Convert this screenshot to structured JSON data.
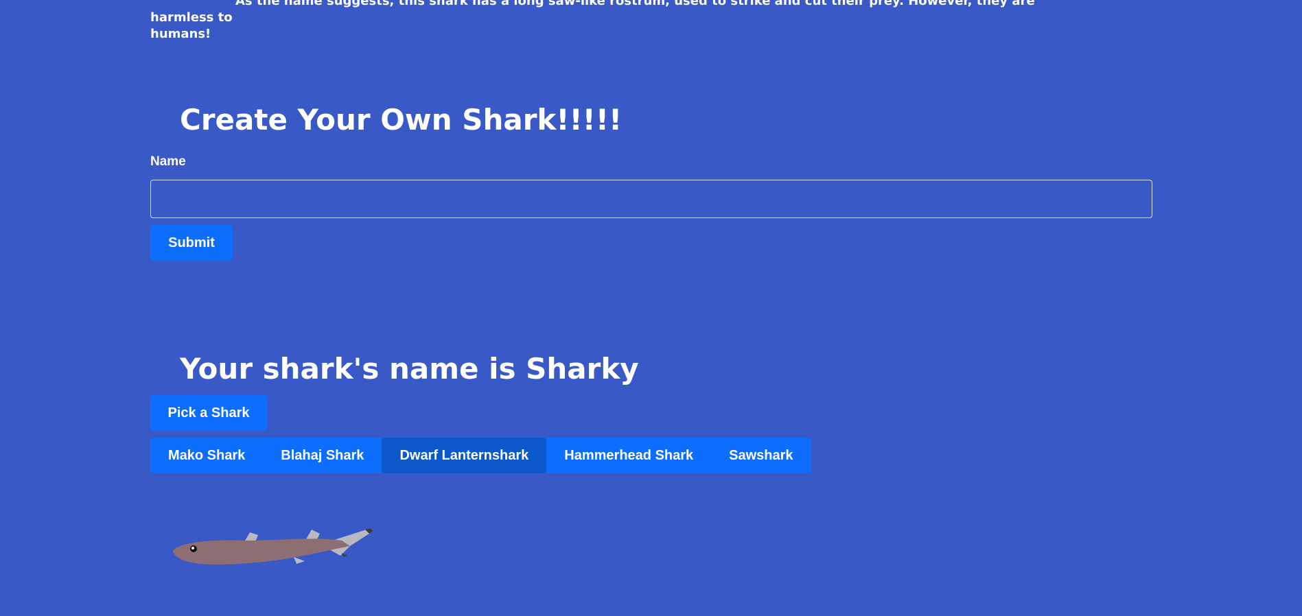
{
  "intro": {
    "line1": "As the name suggests, this shark has a long saw-like rostrum, used to strike and cut their prey. However, they are harmless to",
    "line2": "humans!"
  },
  "create_form": {
    "title": "Create Your Own Shark!!!!!",
    "name_label": "Name",
    "name_value": "",
    "submit_label": "Submit"
  },
  "result": {
    "title": "Your shark's name is Sharky",
    "pick_label": "Pick a Shark",
    "sharks": [
      {
        "label": "Mako Shark",
        "active": false
      },
      {
        "label": "Blahaj Shark",
        "active": false
      },
      {
        "label": "Dwarf Lanternshark",
        "active": true
      },
      {
        "label": "Hammerhead Shark",
        "active": false
      },
      {
        "label": "Sawshark",
        "active": false
      }
    ],
    "selected_image": "dwarf-lanternshark-illustration"
  },
  "colors": {
    "background": "#3959c6",
    "button": "#0d6efd",
    "button_active": "#0a58ca",
    "shark_body": "#8d6f73"
  }
}
